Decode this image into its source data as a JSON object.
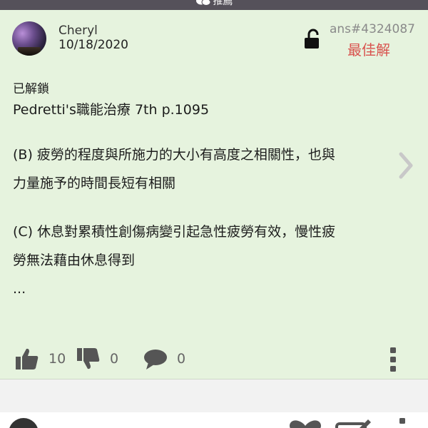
{
  "topbar": {
    "label": "推薦",
    "icon": "chat-bubbles-icon"
  },
  "answer": {
    "username": "Cheryl",
    "date": "10/18/2020",
    "answer_id": "ans#4324087",
    "best_label": "最佳解",
    "lock_icon": "unlocked-lock-icon",
    "unlocked_text": "已解鎖",
    "source": "Pedretti's職能治療 7th p.1095",
    "option_b": [
      "(B) 疲勞的程度與所施力的大小有高度之相關性，也與",
      "力量施予的時間長短有相關"
    ],
    "option_c": [
      "(C) 休息對累積性創傷病變引起急性疲勞有效，慢性疲",
      "勞無法藉由休息得到"
    ],
    "ellipsis": "...",
    "likes": "10",
    "dislikes": "0",
    "comments": "0"
  },
  "colors": {
    "card_bg": "#e6f3de",
    "best": "#d9534f",
    "topbar": "#55515a"
  }
}
